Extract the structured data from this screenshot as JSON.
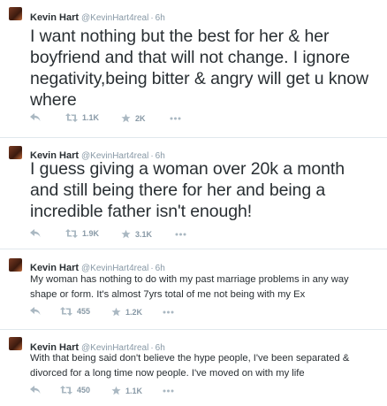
{
  "tweets": [
    {
      "name": "Kevin Hart",
      "handle": "@KevinHart4real",
      "dot": "·",
      "time": "6h",
      "text": "I want nothing but the best for her & her boyfriend and that will not change. I ignore negativity,being bitter & angry will get u know where",
      "retweets": "1.1K",
      "favorites": "2K"
    },
    {
      "name": "Kevin Hart",
      "handle": "@KevinHart4real",
      "dot": "·",
      "time": "6h",
      "text": "I guess giving a woman over 20k a month and still being there for her and being a incredible father isn't enough!",
      "retweets": "1.9K",
      "favorites": "3.1K"
    },
    {
      "name": "Kevin Hart",
      "handle": "@KevinHart4real",
      "dot": "·",
      "time": "6h",
      "text": "My woman has nothing to do with my past marriage problems in any way shape or form. It's almost 7yrs total of me not being with my Ex",
      "retweets": "455",
      "favorites": "1.2K"
    },
    {
      "name": "Kevin Hart",
      "handle": "@KevinHart4real",
      "dot": "·",
      "time": "6h",
      "text": "With that being said don't believe the hype people, I've been separated & divorced for a long time now people. I've moved on with my life",
      "retweets": "450",
      "favorites": "1.1K"
    }
  ],
  "icons": {
    "reply": "reply-icon",
    "retweet": "retweet-icon",
    "favorite": "star-icon",
    "more": "more-icon"
  },
  "colors": {
    "icon": "#aab8c2",
    "meta": "#8899a6",
    "text": "#292f33",
    "divider": "#e1e8ed"
  }
}
